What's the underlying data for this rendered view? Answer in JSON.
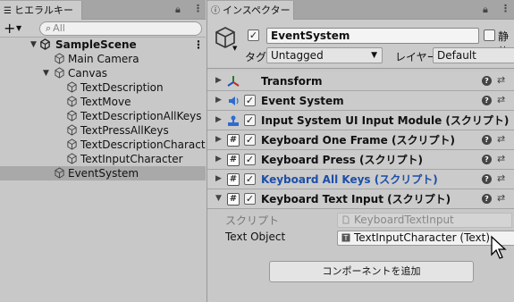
{
  "hierarchy": {
    "tab_title": "ヒエラルキー",
    "search_placeholder": "All",
    "scene_name": "SampleScene",
    "items": [
      {
        "label": "Main Camera"
      },
      {
        "label": "Canvas"
      },
      {
        "label": "TextDescription"
      },
      {
        "label": "TextMove"
      },
      {
        "label": "TextDescriptionAllKeys"
      },
      {
        "label": "TextPressAllKeys"
      },
      {
        "label": "TextDescriptionCharacter"
      },
      {
        "label": "TextInputCharacter"
      },
      {
        "label": "EventSystem"
      }
    ]
  },
  "inspector": {
    "tab_title": "インスペクター",
    "object_name": "EventSystem",
    "static_label": "静的",
    "tag_label": "タグ",
    "tag_value": "Untagged",
    "layer_label": "レイヤー",
    "layer_value": "Default",
    "components": [
      {
        "title": "Transform"
      },
      {
        "title": "Event System"
      },
      {
        "title": "Input System UI Input Module (スクリプト)"
      },
      {
        "title": "Keyboard One Frame (スクリプト)"
      },
      {
        "title": "Keyboard Press (スクリプト)"
      },
      {
        "title": "Keyboard All Keys (スクリプト)"
      },
      {
        "title": "Keyboard Text Input (スクリプト)"
      }
    ],
    "script_label": "スクリプト",
    "script_value": "KeyboardTextInput",
    "text_object_label": "Text Object",
    "text_object_value": "TextInputCharacter (Text)",
    "add_component_label": "コンポーネントを追加"
  },
  "colors": {
    "link_blue": "#1c4ea8",
    "selection": "#a9a9a9"
  }
}
